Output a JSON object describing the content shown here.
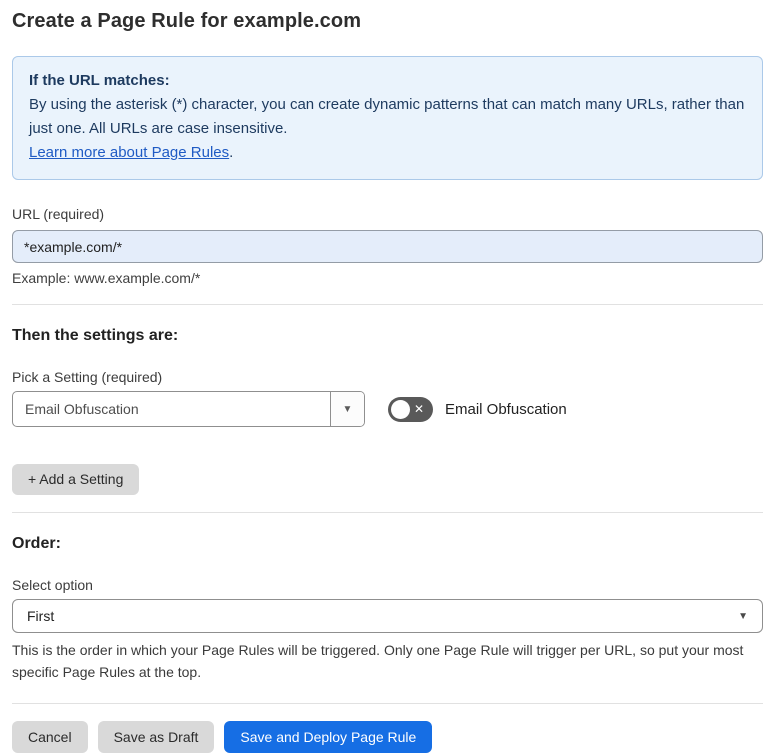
{
  "page": {
    "title": "Create a Page Rule for example.com"
  },
  "info_box": {
    "heading": "If the URL matches:",
    "body": "By using the asterisk (*) character, you can create dynamic patterns that can match many URLs, rather than just one. All URLs are case insensitive.",
    "link": "Learn more about Page Rules",
    "link_suffix": "."
  },
  "url_field": {
    "label": "URL (required)",
    "value": "*example.com/*",
    "example": "Example: www.example.com/*"
  },
  "settings_section": {
    "heading": "Then the settings are:",
    "picker_label": "Pick a Setting (required)",
    "picker_value": "Email Obfuscation",
    "toggle_state": "off",
    "toggle_label": "Email Obfuscation",
    "add_button": "+ Add a Setting"
  },
  "order_section": {
    "heading": "Order:",
    "select_label": "Select option",
    "select_value": "First",
    "help": "This is the order in which your Page Rules will be triggered. Only one Page Rule will trigger per URL, so put your most specific Page Rules at the top."
  },
  "footer": {
    "cancel": "Cancel",
    "save_draft": "Save as Draft",
    "save_deploy": "Save and Deploy Page Rule"
  },
  "icons": {
    "caret_down": "▼",
    "toggle_off_x": "✕"
  },
  "colors": {
    "accent_blue": "#166ee4",
    "info_bg": "#eaf3fc",
    "info_border": "#abc9e9",
    "info_text": "#1d3a5f",
    "link_blue": "#1f5bc4",
    "input_bg": "#e4edfa",
    "toggle_off_gray": "#595959",
    "button_gray": "#d9d9d9"
  }
}
